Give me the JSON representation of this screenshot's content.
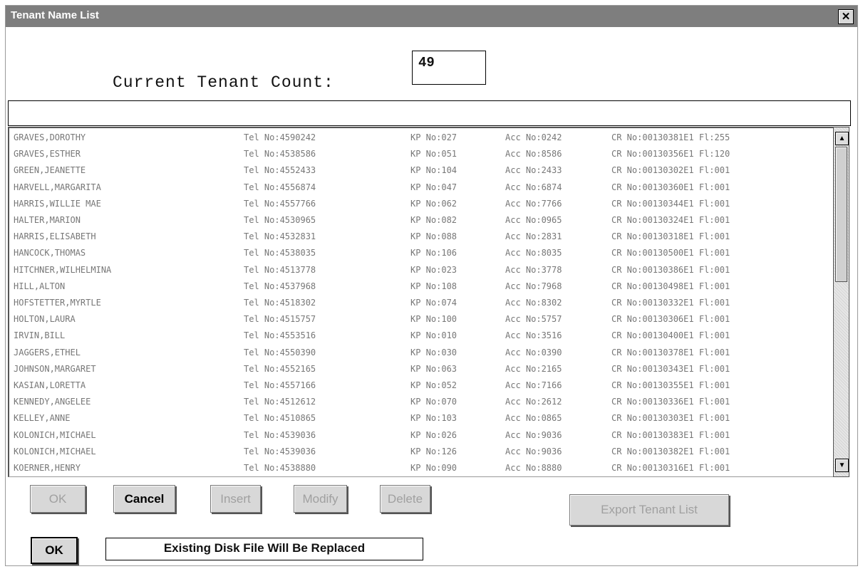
{
  "window": {
    "title": "Tenant Name List",
    "close_glyph": "✕"
  },
  "tenant_count": {
    "label": "Current Tenant Count:",
    "value": "49"
  },
  "filter": {
    "value": ""
  },
  "tenants": [
    {
      "name": "GRAVES,DOROTHY",
      "tel": "Tel No:4590242",
      "kp": "KP No:027",
      "acc": "Acc No:0242",
      "cr": "CR No:00130381E1 Fl:255"
    },
    {
      "name": "GRAVES,ESTHER",
      "tel": "Tel No:4538586",
      "kp": "KP No:051",
      "acc": "Acc No:8586",
      "cr": "CR No:00130356E1 Fl:120"
    },
    {
      "name": "GREEN,JEANETTE",
      "tel": "Tel No:4552433",
      "kp": "KP No:104",
      "acc": "Acc No:2433",
      "cr": "CR No:00130302E1 Fl:001"
    },
    {
      "name": "HARVELL,MARGARITA",
      "tel": "Tel No:4556874",
      "kp": "KP No:047",
      "acc": "Acc No:6874",
      "cr": "CR No:00130360E1 Fl:001"
    },
    {
      "name": "HARRIS,WILLIE MAE",
      "tel": "Tel No:4557766",
      "kp": "KP No:062",
      "acc": "Acc No:7766",
      "cr": "CR No:00130344E1 Fl:001"
    },
    {
      "name": "HALTER,MARION",
      "tel": "Tel No:4530965",
      "kp": "KP No:082",
      "acc": "Acc No:0965",
      "cr": "CR No:00130324E1 Fl:001"
    },
    {
      "name": "HARRIS,ELISABETH",
      "tel": "Tel No:4532831",
      "kp": "KP No:088",
      "acc": "Acc No:2831",
      "cr": "CR No:00130318E1 Fl:001"
    },
    {
      "name": "HANCOCK,THOMAS",
      "tel": "Tel No:4538035",
      "kp": "KP No:106",
      "acc": "Acc No:8035",
      "cr": "CR No:00130500E1 Fl:001"
    },
    {
      "name": "HITCHNER,WILHELMINA",
      "tel": "Tel No:4513778",
      "kp": "KP No:023",
      "acc": "Acc No:3778",
      "cr": "CR No:00130386E1 Fl:001"
    },
    {
      "name": "HILL,ALTON",
      "tel": "Tel No:4537968",
      "kp": "KP No:108",
      "acc": "Acc No:7968",
      "cr": "CR No:00130498E1 Fl:001"
    },
    {
      "name": "HOFSTETTER,MYRTLE",
      "tel": "Tel No:4518302",
      "kp": "KP No:074",
      "acc": "Acc No:8302",
      "cr": "CR No:00130332E1 Fl:001"
    },
    {
      "name": "HOLTON,LAURA",
      "tel": "Tel No:4515757",
      "kp": "KP No:100",
      "acc": "Acc No:5757",
      "cr": "CR No:00130306E1 Fl:001"
    },
    {
      "name": "IRVIN,BILL",
      "tel": "Tel No:4553516",
      "kp": "KP No:010",
      "acc": "Acc No:3516",
      "cr": "CR No:00130400E1 Fl:001"
    },
    {
      "name": "JAGGERS,ETHEL",
      "tel": "Tel No:4550390",
      "kp": "KP No:030",
      "acc": "Acc No:0390",
      "cr": "CR No:00130378E1 Fl:001"
    },
    {
      "name": "JOHNSON,MARGARET",
      "tel": "Tel No:4552165",
      "kp": "KP No:063",
      "acc": "Acc No:2165",
      "cr": "CR No:00130343E1 Fl:001"
    },
    {
      "name": "KASIAN,LORETTA",
      "tel": "Tel No:4557166",
      "kp": "KP No:052",
      "acc": "Acc No:7166",
      "cr": "CR No:00130355E1 Fl:001"
    },
    {
      "name": "KENNEDY,ANGELEE",
      "tel": "Tel No:4512612",
      "kp": "KP No:070",
      "acc": "Acc No:2612",
      "cr": "CR No:00130336E1 Fl:001"
    },
    {
      "name": "KELLEY,ANNE",
      "tel": "Tel No:4510865",
      "kp": "KP No:103",
      "acc": "Acc No:0865",
      "cr": "CR No:00130303E1 Fl:001"
    },
    {
      "name": "KOLONICH,MICHAEL",
      "tel": "Tel No:4539036",
      "kp": "KP No:026",
      "acc": "Acc No:9036",
      "cr": "CR No:00130383E1 Fl:001"
    },
    {
      "name": "KOLONICH,MICHAEL",
      "tel": "Tel No:4539036",
      "kp": "KP No:126",
      "acc": "Acc No:9036",
      "cr": "CR No:00130382E1 Fl:001"
    },
    {
      "name": "KOERNER,HENRY",
      "tel": "Tel No:4538880",
      "kp": "KP No:090",
      "acc": "Acc No:8880",
      "cr": "CR No:00130316E1 Fl:001"
    }
  ],
  "scrollbar": {
    "up_glyph": "▲",
    "down_glyph": "▼"
  },
  "buttons": {
    "ok": "OK",
    "cancel": "Cancel",
    "insert": "Insert",
    "modify": "Modify",
    "delete": "Delete",
    "export": "Export  Tenant List",
    "confirm_ok": "OK"
  },
  "notice": "Existing Disk File Will Be Replaced"
}
